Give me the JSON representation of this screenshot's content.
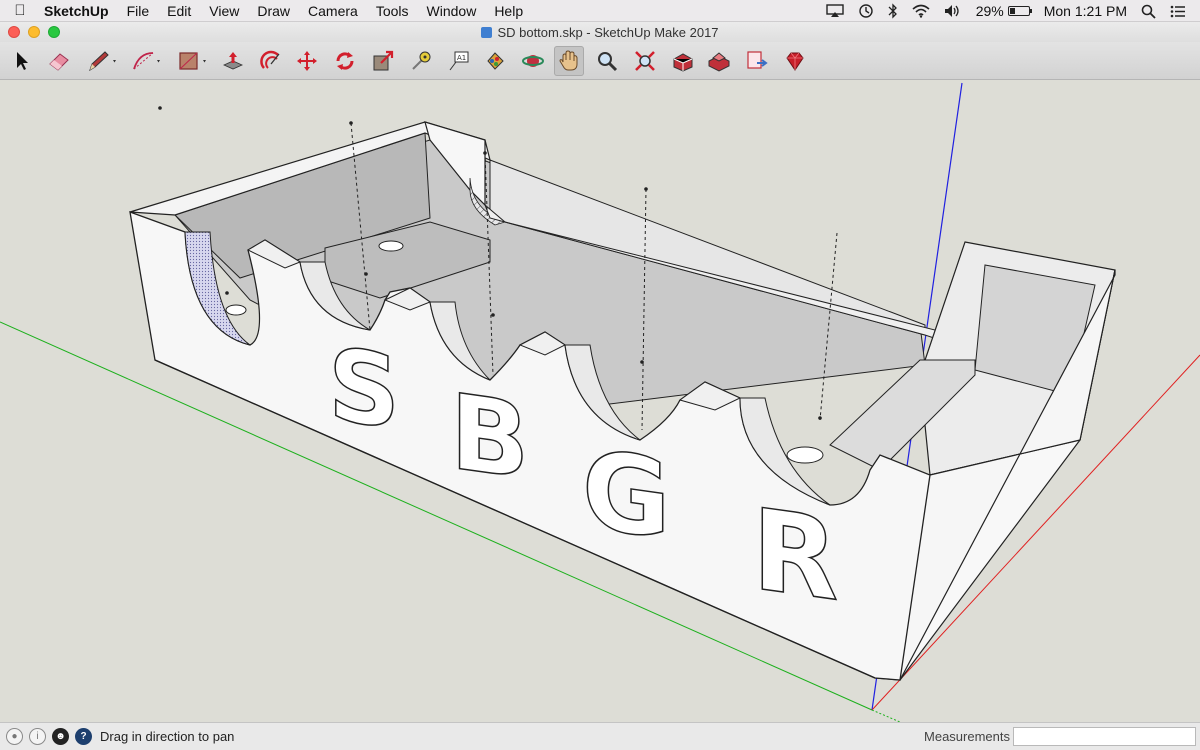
{
  "menubar": {
    "apple_icon": "apple-logo",
    "items": [
      "SketchUp",
      "File",
      "Edit",
      "View",
      "Draw",
      "Camera",
      "Tools",
      "Window",
      "Help"
    ],
    "battery_percent": "29%",
    "battery_level": 0.29,
    "clock": "Mon 1:21 PM"
  },
  "window": {
    "title": "SD bottom.skp - SketchUp Make 2017"
  },
  "toolbar": {
    "tools": [
      {
        "name": "select-tool",
        "icon": "arrow-cursor-icon"
      },
      {
        "name": "eraser-tool",
        "icon": "eraser-icon"
      },
      {
        "name": "line-tool",
        "icon": "pencil-icon"
      },
      {
        "name": "arc-tool",
        "icon": "arc-icon"
      },
      {
        "name": "rectangle-tool",
        "icon": "rectangle-icon"
      },
      {
        "name": "push-pull-tool",
        "icon": "push-pull-icon"
      },
      {
        "name": "offset-tool",
        "icon": "offset-icon"
      },
      {
        "name": "move-tool",
        "icon": "move-arrows-icon"
      },
      {
        "name": "rotate-tool",
        "icon": "rotate-icon"
      },
      {
        "name": "scale-tool",
        "icon": "scale-icon"
      },
      {
        "name": "tape-measure-tool",
        "icon": "tape-measure-icon"
      },
      {
        "name": "text-tool",
        "icon": "text-icon"
      },
      {
        "name": "paint-bucket-tool",
        "icon": "paint-bucket-icon"
      },
      {
        "name": "orbit-tool",
        "icon": "orbit-icon"
      },
      {
        "name": "pan-tool",
        "icon": "hand-icon"
      },
      {
        "name": "zoom-tool",
        "icon": "magnifier-icon"
      },
      {
        "name": "zoom-extents-tool",
        "icon": "zoom-extents-icon"
      },
      {
        "name": "warehouse-tool",
        "icon": "warehouse-icon"
      },
      {
        "name": "extension-warehouse-tool",
        "icon": "extension-warehouse-icon"
      },
      {
        "name": "send-to-layout-tool",
        "icon": "layout-icon"
      },
      {
        "name": "ruby-tool",
        "icon": "ruby-gem-icon"
      }
    ],
    "active_tool": "pan-tool"
  },
  "model": {
    "letters": [
      "S",
      "B",
      "G",
      "R"
    ]
  },
  "statusbar": {
    "hint": "Drag in direction to pan",
    "measurements_label": "Measurements",
    "measurements_value": ""
  }
}
